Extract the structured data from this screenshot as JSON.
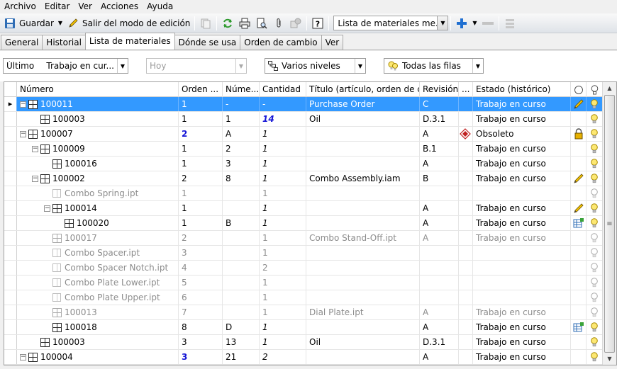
{
  "menu": [
    "Archivo",
    "Editar",
    "Ver",
    "Acciones",
    "Ayuda"
  ],
  "toolbar": {
    "save_label": "Guardar",
    "exit_edit_label": "Salir del modo de edición",
    "view_select_value": "Lista de materiales me..."
  },
  "tabs": [
    "General",
    "Historial",
    "Lista de materiales",
    "Dónde se usa",
    "Orden de cambio",
    "Ver"
  ],
  "active_tab": "Lista de materiales",
  "filters": {
    "revision_label": "Último",
    "revision_state": "Trabajo en cur...",
    "date_value": "Hoy",
    "levels_value": "Varios niveles",
    "rows_value": "Todas las filas"
  },
  "columns": [
    "Número",
    "Orden ...",
    "Núme...",
    "Cantidad",
    "Título (artículo, orden de c...",
    "Revisión",
    "...",
    "Estado (histórico)"
  ],
  "rows": [
    {
      "level": 0,
      "expand": "-",
      "icon": "part",
      "numero": "100011",
      "orden": "1",
      "numero_item": "-",
      "cantidad": "-",
      "titulo": "Purchase Order",
      "revision": "C",
      "estado": "Trabajo en curso",
      "flag": "pencil",
      "selected": true,
      "gray": false
    },
    {
      "level": 1,
      "expand": "",
      "icon": "part",
      "numero": "100003",
      "orden": "1",
      "numero_item": "1",
      "cantidad": "14",
      "titulo": "Oil",
      "revision": "D.3.1",
      "estado": "Trabajo en curso",
      "flag": "",
      "cantidad_style": "blue-bold",
      "gray": false
    },
    {
      "level": 0,
      "expand": "-",
      "icon": "part",
      "numero": "100007",
      "orden": "2",
      "numero_item": "A",
      "cantidad": "1",
      "titulo": "",
      "revision": "A",
      "estado": "Obsoleto",
      "flag": "lock",
      "orden_style": "blue-bold",
      "obsolete": true,
      "gray": false
    },
    {
      "level": 1,
      "expand": "-",
      "icon": "part",
      "numero": "100009",
      "orden": "1",
      "numero_item": "2",
      "cantidad": "1",
      "titulo": "",
      "revision": "B.1",
      "estado": "Trabajo en curso",
      "flag": "",
      "gray": false
    },
    {
      "level": 2,
      "expand": "",
      "icon": "part",
      "numero": "100016",
      "orden": "1",
      "numero_item": "3",
      "cantidad": "1",
      "titulo": "",
      "revision": "A",
      "estado": "Trabajo en curso",
      "flag": "",
      "gray": false
    },
    {
      "level": 1,
      "expand": "-",
      "icon": "part",
      "numero": "100002",
      "orden": "2",
      "numero_item": "8",
      "cantidad": "1",
      "titulo": "Combo Assembly.iam",
      "revision": "B",
      "estado": "Trabajo en curso",
      "flag": "pencil",
      "gray": false
    },
    {
      "level": 2,
      "expand": "",
      "icon": "file",
      "numero": "Combo Spring.ipt",
      "orden": "1",
      "numero_item": "",
      "cantidad": "1",
      "titulo": "",
      "revision": "",
      "estado": "",
      "flag": "",
      "gray": true
    },
    {
      "level": 2,
      "expand": "-",
      "icon": "part",
      "numero": "100014",
      "orden": "1",
      "numero_item": "",
      "cantidad": "1",
      "titulo": "",
      "revision": "A",
      "estado": "Trabajo en curso",
      "flag": "pencil",
      "gray": false
    },
    {
      "level": 3,
      "expand": "",
      "icon": "part",
      "numero": "100020",
      "orden": "1",
      "numero_item": "B",
      "cantidad": "1",
      "titulo": "",
      "revision": "A",
      "estado": "Trabajo en curso",
      "flag": "table",
      "gray": false
    },
    {
      "level": 2,
      "expand": "",
      "icon": "part-ghost",
      "numero": "100017",
      "orden": "2",
      "numero_item": "",
      "cantidad": "1",
      "titulo": "Combo Stand-Off.ipt",
      "revision": "A",
      "estado": "Trabajo en curso",
      "flag": "",
      "gray": true
    },
    {
      "level": 2,
      "expand": "",
      "icon": "file",
      "numero": "Combo Spacer.ipt",
      "orden": "3",
      "numero_item": "",
      "cantidad": "1",
      "titulo": "",
      "revision": "",
      "estado": "",
      "flag": "",
      "gray": true
    },
    {
      "level": 2,
      "expand": "",
      "icon": "file",
      "numero": "Combo Spacer Notch.ipt",
      "orden": "4",
      "numero_item": "",
      "cantidad": "2",
      "titulo": "",
      "revision": "",
      "estado": "",
      "flag": "",
      "gray": true
    },
    {
      "level": 2,
      "expand": "",
      "icon": "file",
      "numero": "Combo Plate Lower.ipt",
      "orden": "5",
      "numero_item": "",
      "cantidad": "1",
      "titulo": "",
      "revision": "",
      "estado": "",
      "flag": "",
      "gray": true
    },
    {
      "level": 2,
      "expand": "",
      "icon": "file",
      "numero": "Combo Plate Upper.ipt",
      "orden": "6",
      "numero_item": "",
      "cantidad": "1",
      "titulo": "",
      "revision": "",
      "estado": "",
      "flag": "",
      "gray": true
    },
    {
      "level": 2,
      "expand": "",
      "icon": "part-ghost",
      "numero": "100013",
      "orden": "7",
      "numero_item": "",
      "cantidad": "1",
      "titulo": "Dial Plate.ipt",
      "revision": "A",
      "estado": "Trabajo en curso",
      "flag": "",
      "gray": true
    },
    {
      "level": 2,
      "expand": "",
      "icon": "part",
      "numero": "100018",
      "orden": "8",
      "numero_item": "D",
      "cantidad": "1",
      "titulo": "",
      "revision": "A",
      "estado": "Trabajo en curso",
      "flag": "table",
      "gray": false
    },
    {
      "level": 1,
      "expand": "",
      "icon": "part",
      "numero": "100003",
      "orden": "3",
      "numero_item": "13",
      "cantidad": "1",
      "titulo": "Oil",
      "revision": "D.3.1",
      "estado": "Trabajo en curso",
      "flag": "",
      "gray": false
    },
    {
      "level": 0,
      "expand": "-",
      "icon": "part",
      "numero": "100004",
      "orden": "3",
      "numero_item": "21",
      "cantidad": "2",
      "titulo": "",
      "revision": "A",
      "estado": "Trabajo en curso",
      "flag": "",
      "orden_style": "blue-bold",
      "gray": false
    }
  ],
  "icons": {
    "save": "save-icon",
    "edit": "pencil-icon",
    "refresh": "refresh-icon",
    "print": "print-icon",
    "preview": "print-preview-icon",
    "attach": "paperclip-icon",
    "help": "help-icon",
    "add": "add-icon"
  },
  "colors": {
    "selection": "#3399ff",
    "emphasis_blue": "#1515d6",
    "gray_text": "#8c8c8c"
  }
}
